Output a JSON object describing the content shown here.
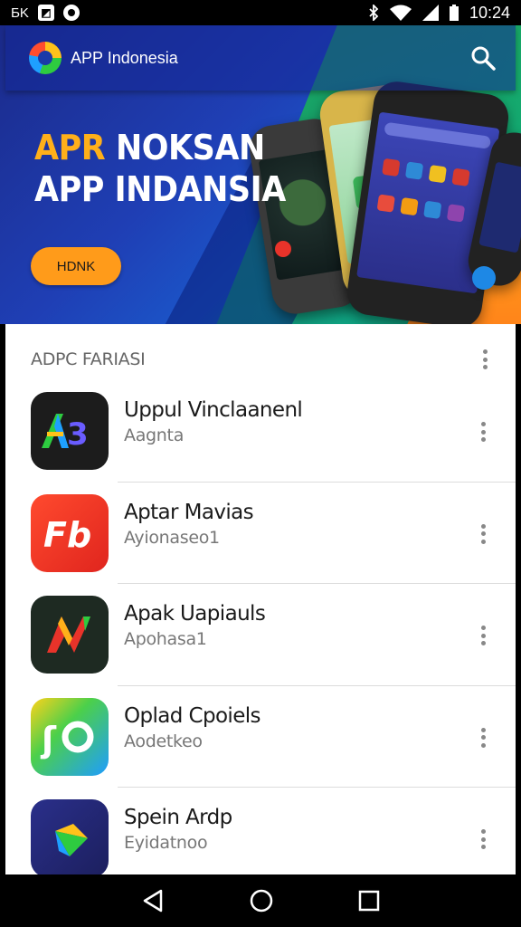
{
  "status_bar": {
    "left_icons": [
      "notification-text-icon",
      "n-box-icon",
      "circle-app-icon"
    ],
    "left_text": "ƂK",
    "right_icons": [
      "bluetooth-icon",
      "wifi-icon",
      "signal-icon",
      "battery-icon"
    ],
    "time": "10:24"
  },
  "header": {
    "brand": "APP Indonesia",
    "search_icon": "search-icon"
  },
  "hero": {
    "title_accent": "APR",
    "title_line1_rest": " NOKSAN",
    "title_line2": "APP INDANSIA",
    "button_label": "HDNK",
    "colors": {
      "accent": "#ffb01a",
      "button": "#ff9b1a",
      "background": "#1f3fb5"
    }
  },
  "section": {
    "title": "ADPC FARIASI",
    "menu_icon": "more-vert-icon"
  },
  "apps": [
    {
      "name": "Uppul Vinclaanenl",
      "subtitle": "Aagnta",
      "icon": "a3-logo-icon"
    },
    {
      "name": "Aptar Mavias",
      "subtitle": "Ayionaseo1",
      "icon": "fb-logo-icon"
    },
    {
      "name": "Apak Uapiauls",
      "subtitle": "Apohasa1",
      "icon": "n-logo-icon"
    },
    {
      "name": "Oplad Cpoiels",
      "subtitle": "Aodetkeo",
      "icon": "o-logo-icon"
    },
    {
      "name": "Spein Ardp",
      "subtitle": "Eyidatnoo",
      "icon": "play-logo-icon"
    }
  ],
  "nav_bar": {
    "back_icon": "back-triangle-icon",
    "home_icon": "home-circle-icon",
    "recents_icon": "recents-square-icon"
  }
}
